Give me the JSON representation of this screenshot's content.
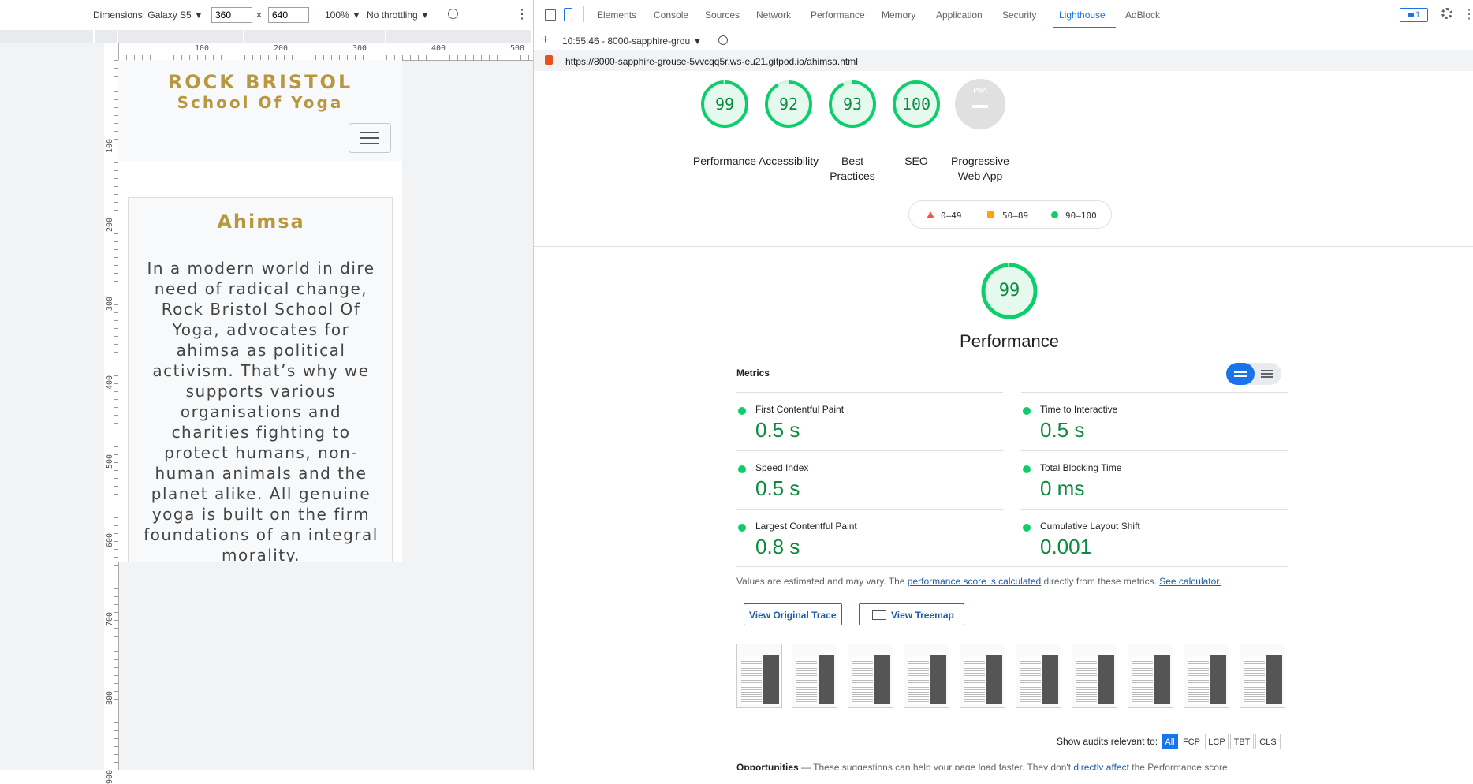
{
  "device_toolbar": {
    "dimensions_label": "Dimensions: Galaxy S5 ▼",
    "width_value": "360",
    "times": "×",
    "height_value": "640",
    "zoom": "100% ▼",
    "throttling": "No throttling ▼",
    "more": "⋮"
  },
  "rulers": {
    "h_ticks": [
      "100",
      "200",
      "300",
      "400",
      "500"
    ],
    "v_ticks": [
      "100",
      "200",
      "300",
      "400",
      "500",
      "600",
      "700",
      "800",
      "900"
    ]
  },
  "mobile_page": {
    "brand_line1": "ROCK BRISTOL",
    "brand_line2": "School Of Yoga",
    "card_title": "Ahimsa",
    "card_text": "In a modern world in dire need of radical change, Rock Bristol School Of Yoga, advocates for ahimsa as political activism. That’s why we supports various organisations and charities fighting to protect humans, non-human animals and the planet alike. All genuine yoga is built on the firm foundations of an integral morality."
  },
  "devtools": {
    "tabs": [
      "Elements",
      "Console",
      "Sources",
      "Network",
      "Performance",
      "Memory",
      "Application",
      "Security",
      "Lighthouse",
      "AdBlock"
    ],
    "active_tab": "Lighthouse",
    "issues_badge": "1",
    "report_selector": "10:55:46 - 8000-sapphire-grou ▼",
    "add": "+",
    "url": "https://8000-sapphire-grouse-5vvcqq5r.ws-eu21.gitpod.io/ahimsa.html"
  },
  "lighthouse": {
    "scores": [
      {
        "label": "Performance",
        "value": "99",
        "fraction": 0.99
      },
      {
        "label": "Accessibility",
        "value": "92",
        "fraction": 0.92
      },
      {
        "label": "Best Practices",
        "value": "93",
        "fraction": 0.93
      },
      {
        "label": "SEO",
        "value": "100",
        "fraction": 1.0
      },
      {
        "label": "Progressive Web App",
        "value": "PWA",
        "fraction": 0
      }
    ],
    "legend": [
      "0–49",
      "50–89",
      "90–100"
    ],
    "main_score": "99",
    "main_score_fraction": 0.99,
    "main_title": "Performance",
    "metrics_heading": "Metrics",
    "metrics": [
      {
        "name": "First Contentful Paint",
        "value": "0.5 s"
      },
      {
        "name": "Time to Interactive",
        "value": "0.5 s"
      },
      {
        "name": "Speed Index",
        "value": "0.5 s"
      },
      {
        "name": "Total Blocking Time",
        "value": "0 ms"
      },
      {
        "name": "Largest Contentful Paint",
        "value": "0.8 s"
      },
      {
        "name": "Cumulative Layout Shift",
        "value": "0.001"
      }
    ],
    "note_prefix": "Values are estimated and may vary. The ",
    "note_link1": "performance score is calculated",
    "note_middle": " directly from these metrics. ",
    "note_link2": "See calculator.",
    "btn_trace": "View Original Trace",
    "btn_treemap": "View Treemap",
    "audits_label": "Show audits relevant to:",
    "audit_filters": [
      "All",
      "FCP",
      "LCP",
      "TBT",
      "CLS"
    ],
    "opps_heading": "Opportunities",
    "opps_text_prefix": " — These suggestions can help your page load faster. They don't ",
    "opps_link": "directly affect",
    "opps_text_suffix": " the Performance score."
  },
  "colors": {
    "pass": "#0cce6b",
    "pass_text": "#0c8a3f",
    "fail": "#ff4e42",
    "average": "#ffa400",
    "accent": "#1a73e8",
    "gold": "#b9973f"
  }
}
